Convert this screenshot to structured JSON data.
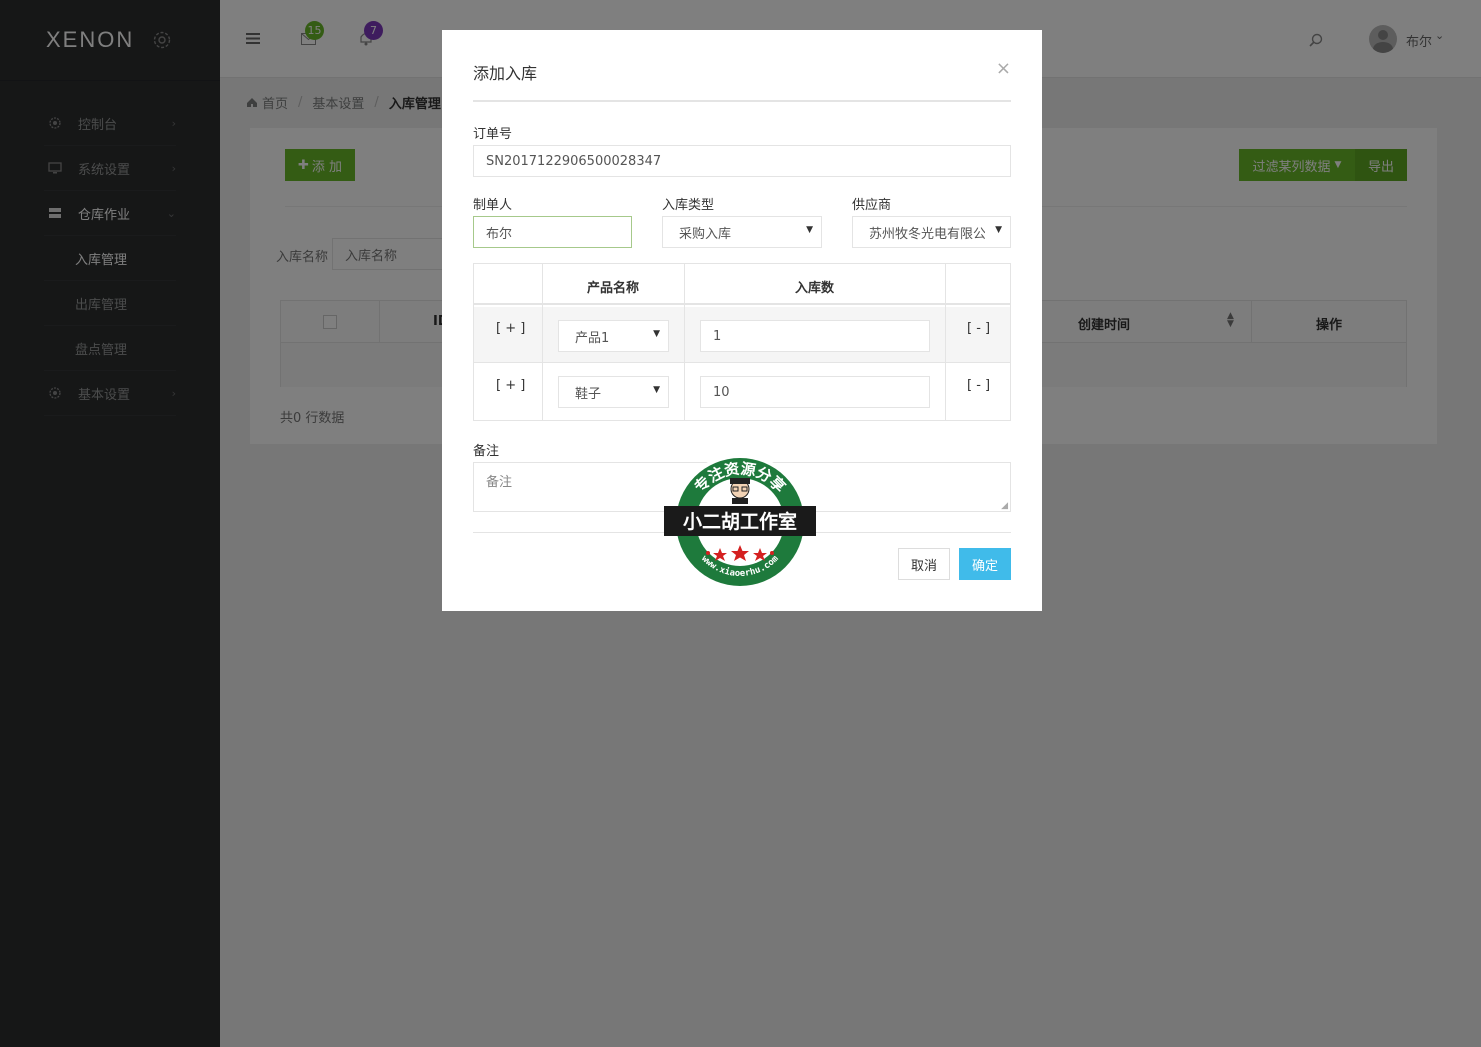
{
  "sidebar": {
    "logo": "XENON",
    "items": [
      {
        "label": "控制台"
      },
      {
        "label": "系统设置"
      },
      {
        "label": "仓库作业"
      },
      {
        "label": "基本设置"
      }
    ],
    "subitems": [
      {
        "label": "入库管理"
      },
      {
        "label": "出库管理"
      },
      {
        "label": "盘点管理"
      }
    ]
  },
  "topbar": {
    "messages_count": "15",
    "notifications_count": "7",
    "username": "布尔"
  },
  "breadcrumb": {
    "home": "首页",
    "level2": "基本设置",
    "level3": "入库管理"
  },
  "page": {
    "add_button": "添 加",
    "filter_button": "过滤某列数据",
    "export_button": "导出",
    "filter_label": "入库名称",
    "filter_placeholder": "入库名称",
    "table_headers": {
      "id": "ID",
      "created": "创建时间",
      "actions": "操作"
    },
    "row_count": "共0 行数据"
  },
  "modal": {
    "title": "添加入库",
    "close": "×",
    "order_no_label": "订单号",
    "order_no_value": "SN2017122906500028347",
    "creator_label": "制单人",
    "creator_value": "布尔",
    "type_label": "入库类型",
    "type_value": "采购入库",
    "supplier_label": "供应商",
    "supplier_value": "苏州牧冬光电有限公",
    "product_table": {
      "headers": [
        "产品名称",
        "入库数"
      ],
      "rows": [
        {
          "add": "[ + ]",
          "product": "产品1",
          "qty": "1",
          "remove": "[ - ]"
        },
        {
          "add": "[ + ]",
          "product": "鞋子",
          "qty": "10",
          "remove": "[ - ]"
        }
      ]
    },
    "remark_label": "备注",
    "remark_placeholder": "备注",
    "cancel_button": "取消",
    "confirm_button": "确定"
  },
  "stamp": {
    "top_text": "专注资源分享",
    "center_text": "小二胡工作室",
    "bottom_text": "www.xiaoerhu.com"
  },
  "colors": {
    "sidebar_bg": "#2c2e2f",
    "accent_green": "#68b828",
    "primary_blue": "#40bbea",
    "badge_green": "#68b828",
    "badge_purple": "#7c38bc"
  }
}
